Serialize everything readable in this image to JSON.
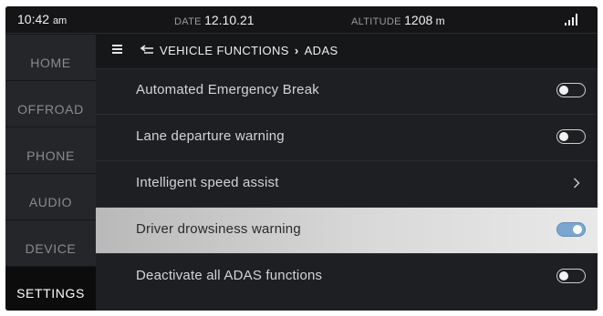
{
  "status": {
    "time": "10:42",
    "ampm": "am",
    "date_label": "DATE",
    "date_value": "12.10.21",
    "altitude_label": "ALTITUDE",
    "altitude_value": "1208",
    "altitude_unit": "m",
    "signal_icon": "signal-strength-icon"
  },
  "sidebar": {
    "items": [
      {
        "label": "HOME",
        "active": false
      },
      {
        "label": "OFFROAD",
        "active": false
      },
      {
        "label": "PHONE",
        "active": false
      },
      {
        "label": "AUDIO",
        "active": false
      },
      {
        "label": "DEVICE",
        "active": false
      },
      {
        "label": "SETTINGS",
        "active": true
      }
    ]
  },
  "header": {
    "menu_icon": "hamburger-menu-icon",
    "back_icon": "back-arrow-icon",
    "parent": "VEHICLE FUNCTIONS",
    "separator": "›",
    "current": "ADAS"
  },
  "settings": [
    {
      "label": "Automated Emergency Break",
      "control": "toggle",
      "on": false
    },
    {
      "label": "Lane departure warning",
      "control": "toggle",
      "on": false
    },
    {
      "label": "Intelligent speed assist",
      "control": "chevron"
    },
    {
      "label": "Driver drowsiness warning",
      "control": "toggle",
      "on": true
    },
    {
      "label": "Deactivate all ADAS functions",
      "control": "toggle",
      "on": false
    }
  ],
  "colors": {
    "background": "#1e1f22",
    "toggle_on": "#7aa6cf",
    "highlight_row": "#d9d9d9"
  }
}
